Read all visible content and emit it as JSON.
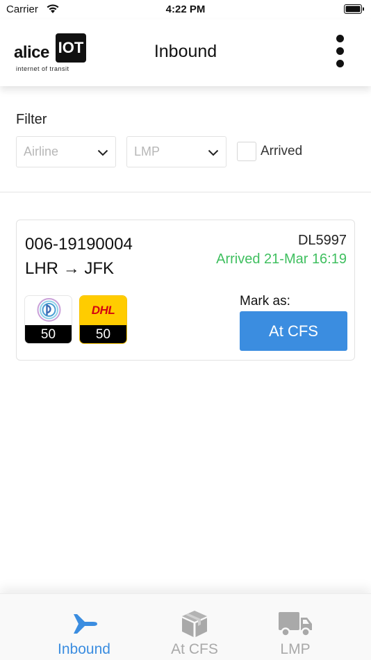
{
  "status_bar": {
    "carrier": "Carrier",
    "time": "4:22 PM"
  },
  "header": {
    "logo": {
      "word": "alice",
      "box": "IOT",
      "tagline": "internet of transit"
    },
    "title": "Inbound",
    "menu_icon": "more-vertical-icon"
  },
  "filter": {
    "label": "Filter",
    "airline_placeholder": "Airline",
    "lmp_placeholder": "LMP",
    "arrived_label": "Arrived",
    "arrived_checked": false
  },
  "shipments": [
    {
      "awb": "006-19190004",
      "origin": "LHR",
      "destination": "JFK",
      "route_arrow": "→",
      "flight": "DL5997",
      "status": "Arrived 21-Mar 16:19",
      "status_color": "#3fbf5f",
      "carriers": [
        {
          "logo": "pitney-bowes-logo",
          "count": "50"
        },
        {
          "logo": "dhl-logo",
          "logo_text": "DHL",
          "count": "50"
        }
      ],
      "mark_as_label": "Mark as:",
      "action_label": "At CFS"
    }
  ],
  "tab_bar": {
    "active": "Inbound",
    "accent": "#3b8de0",
    "tabs": [
      {
        "label": "Inbound",
        "icon": "airplane-icon"
      },
      {
        "label": "At CFS",
        "icon": "package-icon"
      },
      {
        "label": "LMP",
        "icon": "truck-icon"
      }
    ]
  }
}
